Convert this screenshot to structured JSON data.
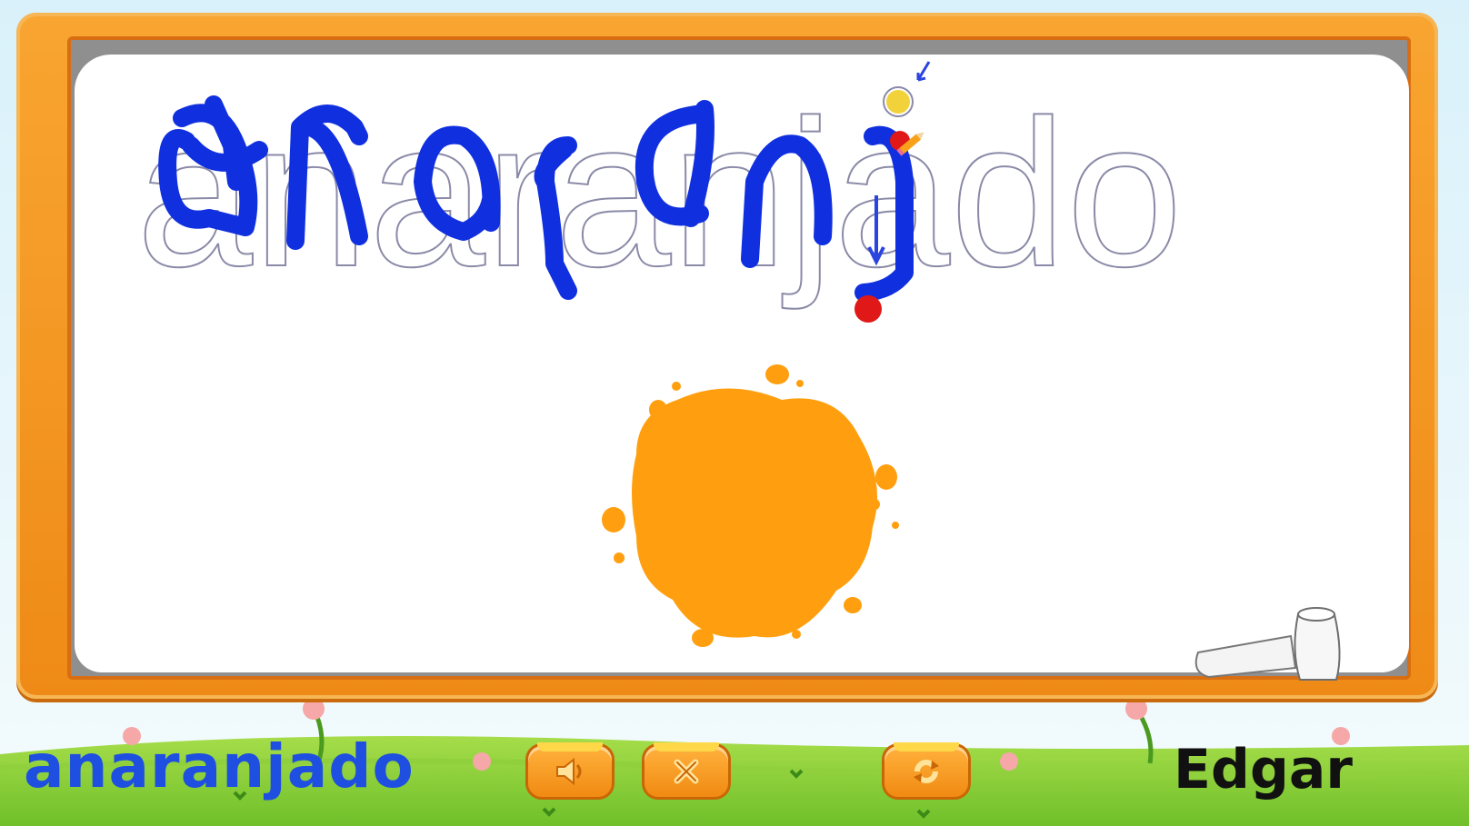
{
  "game": {
    "target_word": "anaranjado",
    "color_name": "anaranjado",
    "splash_color": "#ff9f0f",
    "trace_color": "#1030e0",
    "outline_color": "#8a8aa8"
  },
  "player": {
    "name": "Edgar"
  },
  "controls": {
    "sound": {
      "icon": "speaker-icon"
    },
    "clear": {
      "icon": "close-icon"
    },
    "restart": {
      "icon": "refresh-icon"
    }
  },
  "tools": {
    "eraser": {
      "icon": "eraser-icon"
    }
  }
}
